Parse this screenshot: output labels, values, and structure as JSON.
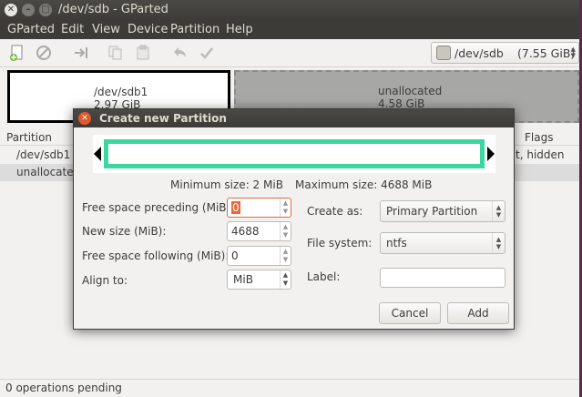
{
  "window": {
    "title": "/dev/sdb - GParted"
  },
  "menu": [
    "GParted",
    "Edit",
    "View",
    "Device",
    "Partition",
    "Help"
  ],
  "device_selector": {
    "name": "/dev/sdb",
    "size": "(7.55 GiB)"
  },
  "disk_map": {
    "partition": {
      "name": "/dev/sdb1",
      "size": "2.97 GiB"
    },
    "unallocated": {
      "name": "unallocated",
      "size": "4.58 GiB"
    }
  },
  "partition_list": {
    "headers": {
      "partition": "Partition",
      "flags": "Flags"
    },
    "rows": [
      {
        "partition": "/dev/sdb1",
        "flags": "t, hidden"
      },
      {
        "partition": "unallocated",
        "flags": ""
      }
    ]
  },
  "status": "0 operations pending",
  "dialog": {
    "title": "Create new Partition",
    "min_size": "Minimum size: 2 MiB",
    "max_size": "Maximum size: 4688 MiB",
    "labels": {
      "free_preceding": "Free space preceding (MiB):",
      "new_size": "New size (MiB):",
      "free_following": "Free space following (MiB):",
      "align_to": "Align to:",
      "create_as": "Create as:",
      "file_system": "File system:",
      "label": "Label:"
    },
    "values": {
      "free_preceding": "0",
      "new_size": "4688",
      "free_following": "0",
      "align_to": "MiB",
      "create_as": "Primary Partition",
      "file_system": "ntfs",
      "label": ""
    },
    "buttons": {
      "cancel": "Cancel",
      "add": "Add"
    }
  }
}
